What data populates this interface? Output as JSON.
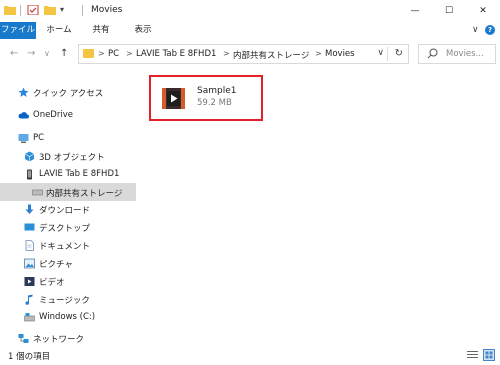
{
  "window": {
    "title": "Movies",
    "controls": {
      "minimize": "—",
      "maximize": "☐",
      "close": "✕"
    }
  },
  "ribbon": {
    "tabs": [
      "ファイル",
      "ホーム",
      "共有",
      "表示"
    ],
    "collapse_glyph": "∨",
    "help_glyph": "?"
  },
  "address": {
    "back_glyph": "←",
    "forward_glyph": "→",
    "recent_glyph": "∨",
    "up_glyph": "↑",
    "crumbs": [
      "PC",
      "LAVIE Tab E 8FHD1",
      "内部共有ストレージ",
      "Movies"
    ],
    "separator": ">",
    "dropdown_glyph": "∨",
    "refresh_glyph": "↻"
  },
  "search": {
    "placeholder": "Movies...",
    "icon": "search-icon"
  },
  "sidebar": {
    "items": [
      {
        "label": "クイック アクセス",
        "icon": "star-icon"
      },
      {
        "label": "OneDrive",
        "icon": "cloud-icon"
      },
      {
        "label": "PC",
        "icon": "pc-icon"
      },
      {
        "label": "3D オブジェクト",
        "icon": "cube-icon"
      },
      {
        "label": "LAVIE Tab E 8FHD1",
        "icon": "tablet-icon"
      },
      {
        "label": "内部共有ストレージ",
        "icon": "storage-icon",
        "selected": true
      },
      {
        "label": "ダウンロード",
        "icon": "download-icon"
      },
      {
        "label": "デスクトップ",
        "icon": "desktop-icon"
      },
      {
        "label": "ドキュメント",
        "icon": "document-icon"
      },
      {
        "label": "ピクチャ",
        "icon": "picture-icon"
      },
      {
        "label": "ビデオ",
        "icon": "video-icon"
      },
      {
        "label": "ミュージック",
        "icon": "music-icon"
      },
      {
        "label": "Windows (C:)",
        "icon": "drive-icon"
      },
      {
        "label": "ネットワーク",
        "icon": "network-icon"
      }
    ]
  },
  "files": [
    {
      "name": "Sample1",
      "size": "59.2 MB",
      "icon": "video-file-icon"
    }
  ],
  "status": {
    "item_count": "1 個の項目"
  },
  "colors": {
    "accent": "#1979ca",
    "highlight_border": "#e4202a",
    "selection": "#d9d9d9"
  }
}
